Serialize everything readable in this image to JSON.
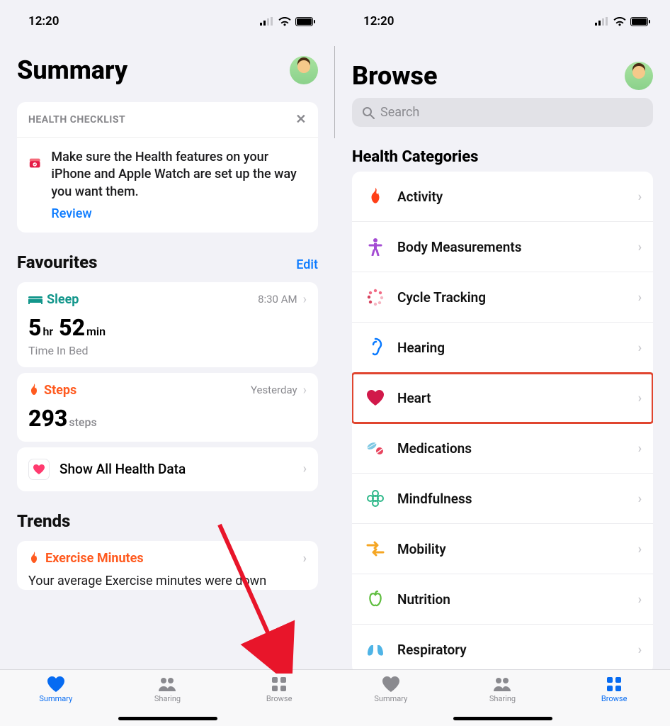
{
  "status": {
    "time": "12:20"
  },
  "summary": {
    "title": "Summary",
    "checklist": {
      "header": "HEALTH CHECKLIST",
      "text": "Make sure the Health features on your iPhone and Apple Watch are set up the way you want them.",
      "review": "Review"
    },
    "favourites": {
      "title": "Favourites",
      "edit": "Edit",
      "sleep": {
        "label": "Sleep",
        "time": "8:30 AM",
        "hours": "5",
        "hrUnit": "hr",
        "minutes": "52",
        "minUnit": "min",
        "caption": "Time In Bed"
      },
      "steps": {
        "label": "Steps",
        "when": "Yesterday",
        "value": "293",
        "unit": "steps"
      },
      "showAll": "Show All Health Data"
    },
    "trends": {
      "title": "Trends",
      "exercise": {
        "label": "Exercise Minutes",
        "desc": "Your average Exercise minutes were down"
      }
    }
  },
  "browse": {
    "title": "Browse",
    "searchPlaceholder": "Search",
    "categoriesHeader": "Health Categories",
    "categories": [
      {
        "label": "Activity"
      },
      {
        "label": "Body Measurements"
      },
      {
        "label": "Cycle Tracking"
      },
      {
        "label": "Hearing"
      },
      {
        "label": "Heart"
      },
      {
        "label": "Medications"
      },
      {
        "label": "Mindfulness"
      },
      {
        "label": "Mobility"
      },
      {
        "label": "Nutrition"
      },
      {
        "label": "Respiratory"
      }
    ]
  },
  "tabs": {
    "summary": "Summary",
    "sharing": "Sharing",
    "browse": "Browse"
  }
}
